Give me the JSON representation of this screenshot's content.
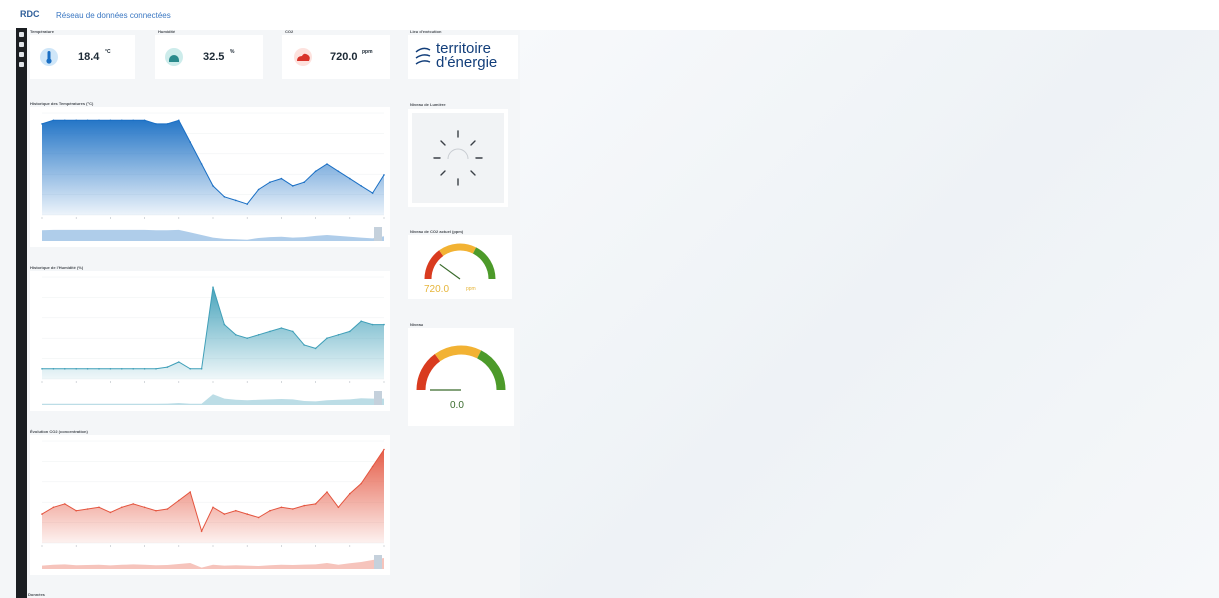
{
  "header": {
    "logo": "RDC",
    "app_title": "Réseau de données connectées",
    "subtitle": "",
    "search_label": ""
  },
  "stats": {
    "temperature": {
      "title": "Température",
      "value": "18.4",
      "unit": "°C"
    },
    "humidity": {
      "title": "Humidité",
      "value": "32.5",
      "unit": "%"
    },
    "co2": {
      "title": "CO2",
      "value": "720.0",
      "unit": "ppm"
    }
  },
  "partner": {
    "title": "Lieu d'exécution",
    "logo_line1": "territoire",
    "logo_line2": "d'énergie",
    "logo_small": ""
  },
  "panels": {
    "temp_chart_title": "Historique des Températures (°C)",
    "humidity_chart_title": "Historique de l'Humidité (%)",
    "co2_chart_title": "Évolution CO2 (concentration)",
    "light_title": "Niveau de Lumière",
    "co2_gauge_title": "Niveau de CO2 actuel (ppm)",
    "gauge2_title": "Niveau",
    "footer_title": "Données"
  },
  "gauges": {
    "co2": {
      "value": 720.0,
      "display": "720.0",
      "unit": "ppm",
      "min": 400,
      "max": 2000
    },
    "level": {
      "value": 0.0,
      "display": "0.0",
      "min": 0,
      "max": 100
    }
  },
  "colors": {
    "temp": "#1a6fc4",
    "humidity": "#3f9fb8",
    "co2": "#e4553f",
    "accent": "#3a77c2",
    "gauge_green": "#4c9a2a",
    "gauge_yellow": "#f2b233",
    "gauge_red": "#d93b1f"
  },
  "chart_data": [
    {
      "type": "area",
      "title": "Historique des Températures (°C)",
      "x": [
        0,
        1,
        2,
        3,
        4,
        5,
        6,
        7,
        8,
        9,
        10,
        11,
        12,
        13,
        14,
        15,
        16,
        17,
        18,
        19,
        20,
        21,
        22,
        23,
        24,
        25,
        26,
        27,
        28,
        29,
        30
      ],
      "series": [
        {
          "values": [
            22.5,
            23,
            23,
            23,
            23,
            23,
            23,
            23,
            23,
            23,
            22.5,
            22.5,
            23,
            20,
            17,
            14,
            12.5,
            12,
            11.5,
            13.5,
            14.5,
            15,
            14,
            14.5,
            16,
            17,
            16,
            15,
            14,
            13,
            15.5
          ]
        }
      ],
      "ylim": [
        10,
        24
      ]
    },
    {
      "type": "area",
      "title": "Historique de l'Humidité (%)",
      "x": [
        0,
        1,
        2,
        3,
        4,
        5,
        6,
        7,
        8,
        9,
        10,
        11,
        12,
        13,
        14,
        15,
        16,
        17,
        18,
        19,
        20,
        21,
        22,
        23,
        24,
        25,
        26,
        27,
        28,
        29,
        30
      ],
      "series": [
        {
          "values": [
            21,
            21,
            21,
            21,
            21,
            21,
            21,
            21,
            21,
            21,
            21,
            21.5,
            23,
            21,
            21,
            45,
            34,
            31,
            30,
            31,
            32,
            33,
            32,
            28,
            27,
            30,
            31,
            32,
            35,
            34,
            34
          ]
        }
      ],
      "ylim": [
        18,
        48
      ]
    },
    {
      "type": "area",
      "title": "Évolution CO2 (concentration)",
      "x": [
        0,
        1,
        2,
        3,
        4,
        5,
        6,
        7,
        8,
        9,
        10,
        11,
        12,
        13,
        14,
        15,
        16,
        17,
        18,
        19,
        20,
        21,
        22,
        23,
        24,
        25,
        26,
        27,
        28,
        29,
        30
      ],
      "series": [
        {
          "values": [
            520,
            560,
            580,
            540,
            550,
            560,
            530,
            560,
            580,
            560,
            540,
            550,
            600,
            650,
            420,
            560,
            520,
            540,
            520,
            500,
            540,
            560,
            550,
            570,
            580,
            650,
            560,
            640,
            700,
            800,
            900
          ]
        }
      ],
      "ylim": [
        350,
        950
      ]
    }
  ]
}
